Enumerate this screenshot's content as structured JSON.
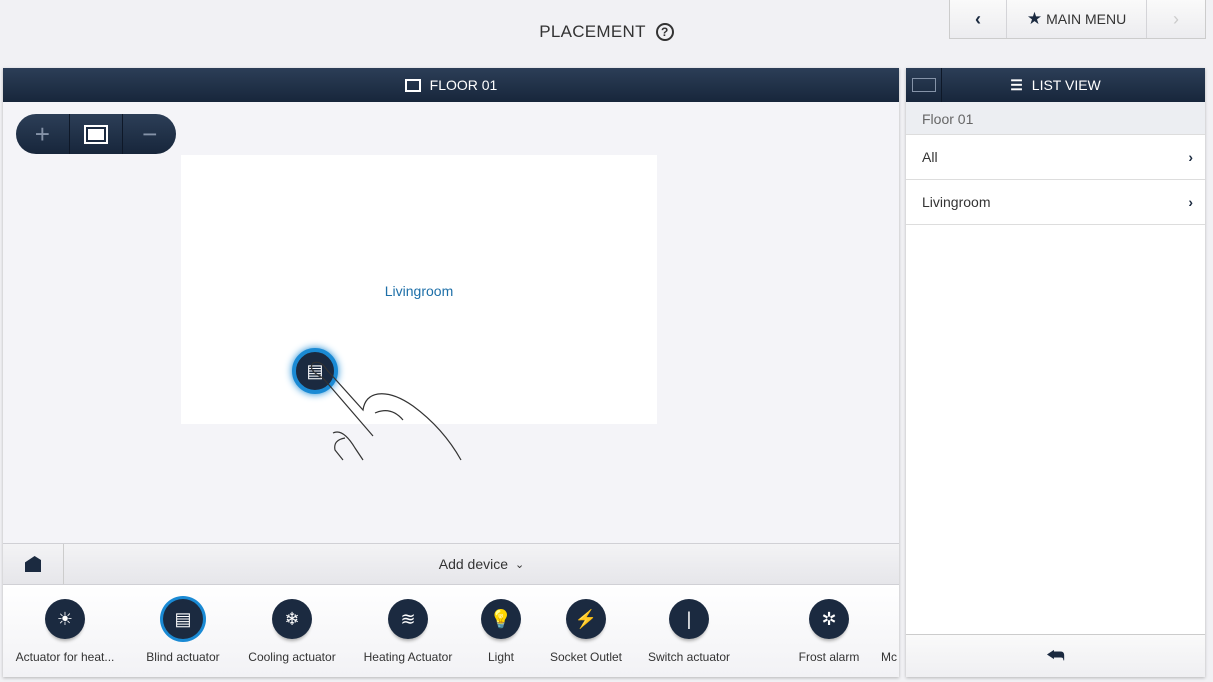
{
  "header": {
    "title": "PLACEMENT",
    "help_icon": "?",
    "back": "‹",
    "main_menu": "MAIN MENU",
    "forward": "›"
  },
  "floor_panel": {
    "title": "FLOOR 01",
    "zoom_in": "+",
    "zoom_fit": "fit",
    "zoom_out": "−",
    "room_label": "Livingroom",
    "add_device": "Add device"
  },
  "devices": [
    {
      "label": "Actuator for heat...",
      "icon": "☀"
    },
    {
      "label": "Blind actuator",
      "icon": "▤",
      "selected": true
    },
    {
      "label": "Cooling actuator",
      "icon": "❄"
    },
    {
      "label": "Heating Actuator",
      "icon": "≋"
    },
    {
      "label": "Light",
      "icon": "💡"
    },
    {
      "label": "Socket Outlet",
      "icon": "⚡"
    },
    {
      "label": "Switch actuator",
      "icon": "|"
    },
    {
      "label": "Frost alarm",
      "icon": "✲"
    },
    {
      "label": "Mc",
      "icon": ""
    }
  ],
  "list_panel": {
    "title": "LIST VIEW",
    "breadcrumb": "Floor 01",
    "items": [
      {
        "label": "All"
      },
      {
        "label": "Livingroom"
      }
    ]
  },
  "colors": {
    "navy": "#1b2a40",
    "accent": "#1a8ad4",
    "room_text": "#1d6fa8"
  }
}
